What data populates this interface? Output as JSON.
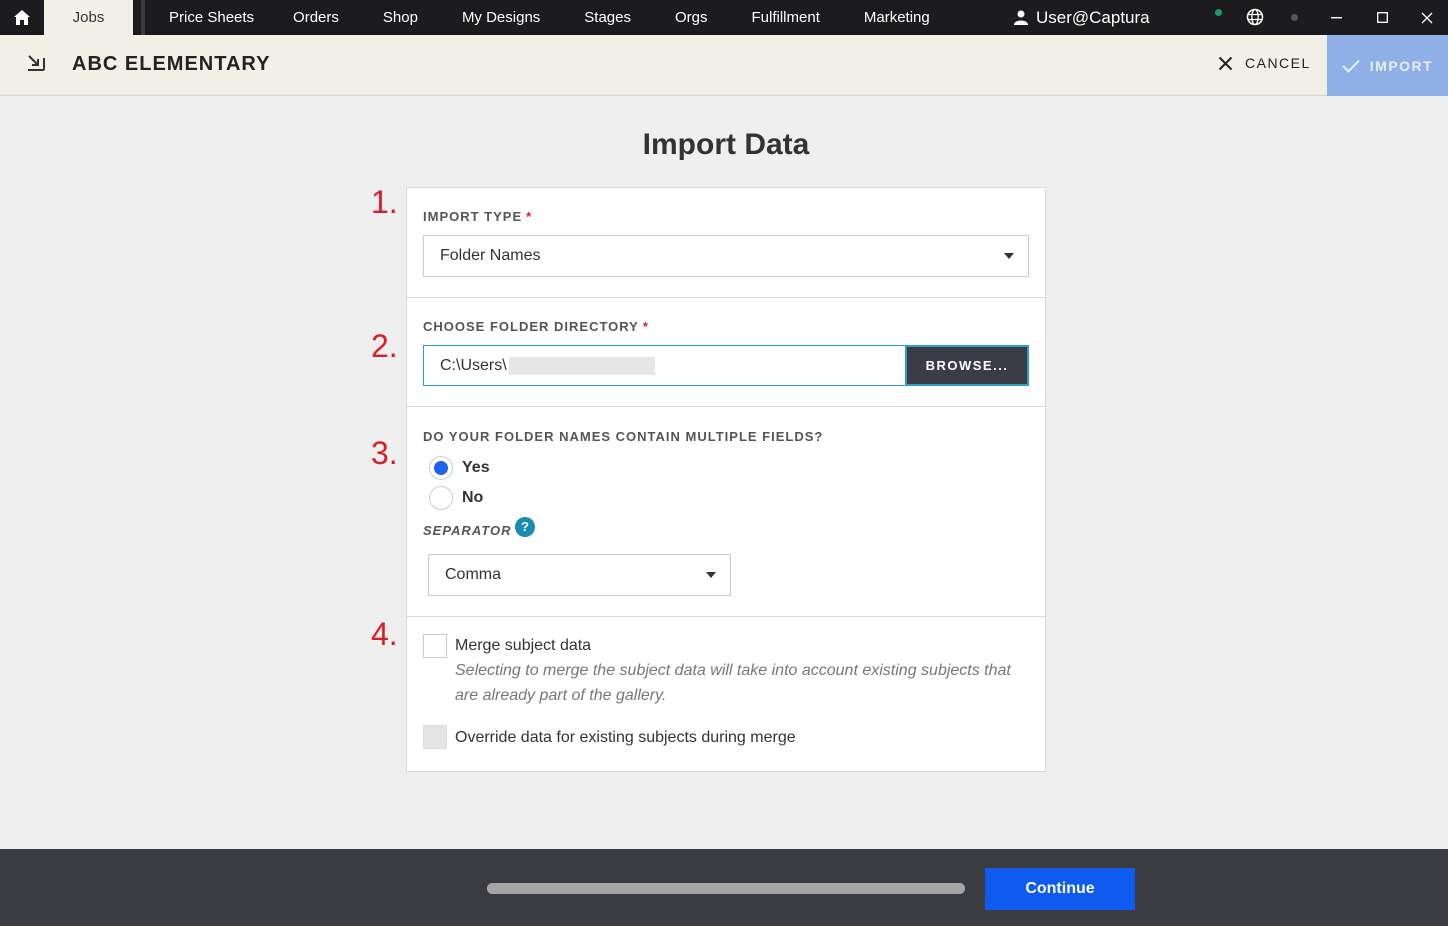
{
  "nav": {
    "home_icon": "home-icon",
    "tabs": [
      "Jobs",
      "Price Sheets",
      "Orders",
      "Shop",
      "My Designs",
      "Stages",
      "Orgs",
      "Fulfillment",
      "Marketing"
    ],
    "active_tab": "Jobs",
    "user": "User@Captura"
  },
  "header": {
    "title": "ABC ELEMENTARY",
    "cancel_label": "CANCEL",
    "import_label": "IMPORT"
  },
  "page": {
    "title": "Import Data"
  },
  "steps": {
    "one": "1.",
    "two": "2.",
    "three": "3.",
    "four": "4."
  },
  "import_type": {
    "label": "IMPORT TYPE",
    "required": "*",
    "value": "Folder Names"
  },
  "folder": {
    "label": "CHOOSE FOLDER DIRECTORY",
    "required": "*",
    "path": "C:\\Users\\",
    "browse_label": "BROWSE..."
  },
  "multi_fields": {
    "question": "DO YOUR FOLDER NAMES CONTAIN MULTIPLE FIELDS?",
    "yes_label": "Yes",
    "no_label": "No",
    "selected": "Yes",
    "separator_label": "SEPARATOR",
    "help_glyph": "?",
    "separator_value": "Comma"
  },
  "merge": {
    "merge_label": "Merge subject data",
    "merge_checked": false,
    "merge_desc": "Selecting to merge the subject data will take into account existing subjects that are already part of the gallery.",
    "override_label": "Override data for existing subjects during merge",
    "override_checked": false,
    "override_disabled": true
  },
  "footer": {
    "progress": 1.0,
    "continue_label": "Continue"
  },
  "colors": {
    "accent": "#0f5bf0",
    "required": "#d61f26",
    "header_bg": "#f1efe6",
    "import_btn": "#8fb0e6"
  }
}
